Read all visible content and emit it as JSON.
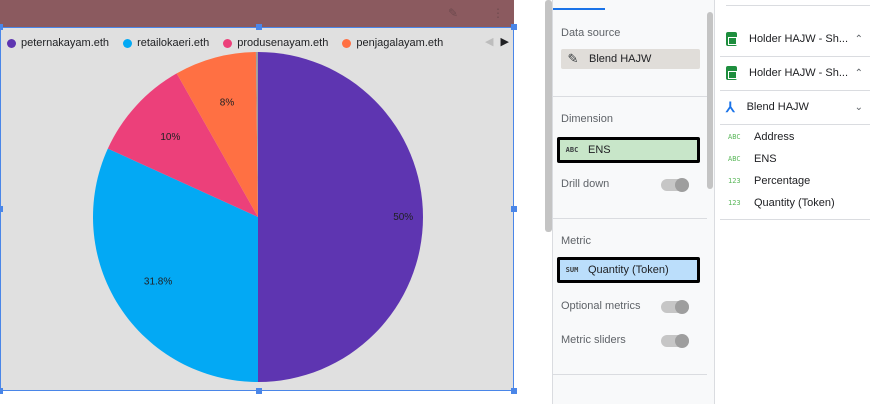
{
  "legend": {
    "items": [
      {
        "label": "peternakayam.eth",
        "color": "#5e35b1"
      },
      {
        "label": "retailokaeri.eth",
        "color": "#03a9f4"
      },
      {
        "label": "produsenayam.eth",
        "color": "#ec407a"
      },
      {
        "label": "penjagalayam.eth",
        "color": "#ff7043"
      }
    ],
    "prev_icon": "◀",
    "next_icon": "▶"
  },
  "chart_data": {
    "type": "pie",
    "slices": [
      {
        "label": "peternakayam.eth",
        "value": 50,
        "display": "50%",
        "color": "#5e35b1"
      },
      {
        "label": "retailokaeri.eth",
        "value": 31.8,
        "display": "31.8%",
        "color": "#03a9f4"
      },
      {
        "label": "produsenayam.eth",
        "value": 10,
        "display": "10%",
        "color": "#ec407a"
      },
      {
        "label": "penjagalayam.eth",
        "value": 8,
        "display": "8%",
        "color": "#ff7043"
      },
      {
        "label": "",
        "value": 0.2,
        "display": "",
        "color": "#9e9e9e"
      }
    ]
  },
  "header_icons": {
    "edit": "✎",
    "more": "⋮"
  },
  "setup": {
    "data_source_title": "Data source",
    "data_source_value": "Blend HAJW",
    "dimension_title": "Dimension",
    "dimension_type": "ABC",
    "dimension_value": "ENS",
    "drill_down_label": "Drill down",
    "metric_title": "Metric",
    "metric_type": "SUM",
    "metric_value": "Quantity (Token)",
    "optional_metrics_label": "Optional metrics",
    "metric_sliders_label": "Metric sliders"
  },
  "data_panel": {
    "sources": [
      {
        "label": "Holder HAJW - Sh..."
      },
      {
        "label": "Holder HAJW - Sh..."
      }
    ],
    "blend_label": "Blend HAJW",
    "fields": [
      {
        "type": "ABC",
        "label": "Address"
      },
      {
        "type": "ABC",
        "label": "ENS"
      },
      {
        "type": "123",
        "label": "Percentage"
      },
      {
        "type": "123",
        "label": "Quantity (Token)"
      }
    ]
  },
  "colors": {
    "chip_dimension": "#c8e6c9",
    "chip_metric": "#bbdefb",
    "chip_source": "#e0ddd9",
    "selection_blue": "#4a86e8"
  }
}
